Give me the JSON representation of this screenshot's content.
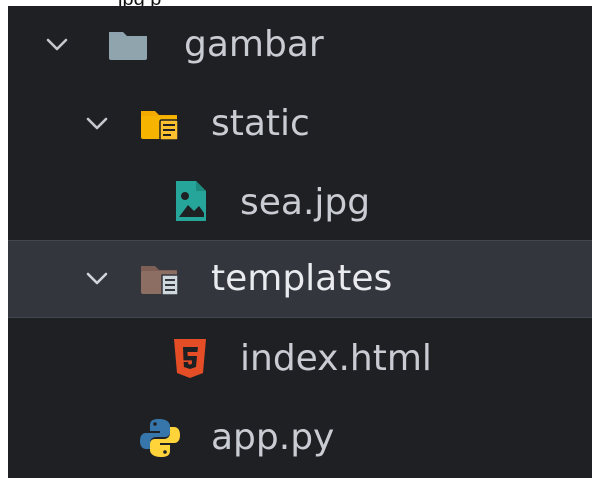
{
  "partial_header": "jpg p",
  "explorer": {
    "items": [
      {
        "label": "gambar",
        "type": "folder",
        "expanded": true,
        "icon": "folder-icon",
        "color": "#90a4ae"
      },
      {
        "label": "static",
        "type": "folder",
        "expanded": true,
        "icon": "folder-static-icon",
        "color": "#f6b400"
      },
      {
        "label": "sea.jpg",
        "type": "file",
        "icon": "image-file-icon",
        "color": "#26a69a"
      },
      {
        "label": "templates",
        "type": "folder",
        "expanded": true,
        "selected": true,
        "icon": "folder-templates-icon",
        "color": "#8d6e63"
      },
      {
        "label": "index.html",
        "type": "file",
        "icon": "html5-icon",
        "color": "#e44d26"
      },
      {
        "label": "app.py",
        "type": "file",
        "icon": "python-icon",
        "color": "#3776ab"
      }
    ]
  }
}
